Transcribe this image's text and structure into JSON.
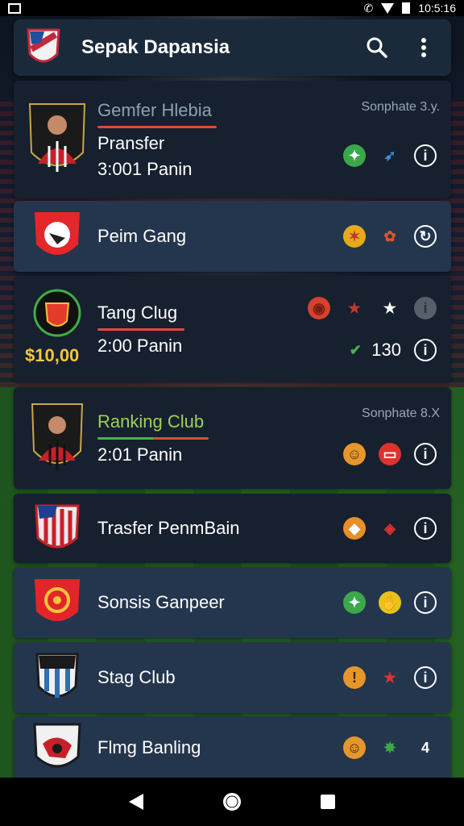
{
  "status": {
    "time": "10:5:16"
  },
  "appbar": {
    "title": "Sepak Dapansia"
  },
  "items": [
    {
      "name": "Gemfer Hlebia",
      "meta": "Sonphate 3.y.",
      "sub1": "Pransfer",
      "sub2": "3:001 Panin",
      "action_value": ""
    },
    {
      "name": "Peim Gang",
      "meta": "",
      "sub1": "",
      "sub2": "",
      "action_value": ""
    },
    {
      "name": "Tang Clug",
      "meta": "",
      "sub1": "",
      "sub2": "2:00 Panin",
      "price": "$10,00",
      "action_value": "130"
    },
    {
      "name": "Ranking Club",
      "meta": "Sonphate 8.X",
      "sub1": "",
      "sub2": "2:01 Panin",
      "action_value": ""
    },
    {
      "name": "Trasfer PenmBain"
    },
    {
      "name": "Sonsis Ganpeer"
    },
    {
      "name": "Stag Club"
    },
    {
      "name": "Flmg Banling"
    }
  ],
  "colors": {
    "accent_red": "#e04a3a",
    "accent_green": "#4caf50",
    "price": "#f5c542"
  },
  "icons": [
    "search-icon",
    "more-vert-icon",
    "back-icon",
    "home-icon",
    "recents-icon"
  ]
}
